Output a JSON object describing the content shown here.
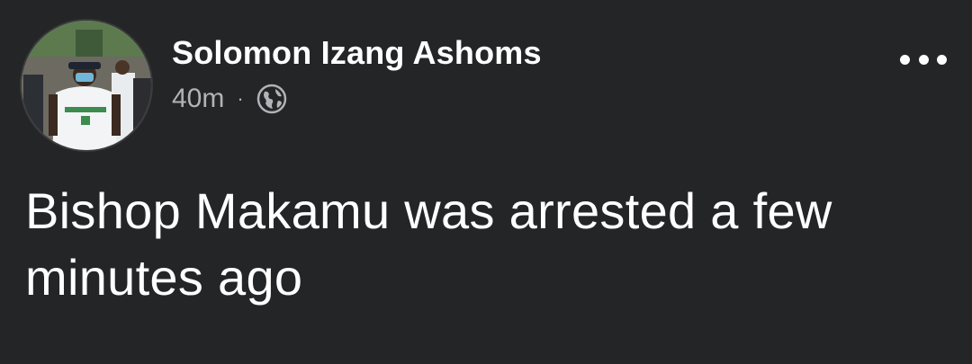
{
  "post": {
    "author_name": "Solomon Izang Ashoms",
    "timestamp": "40m",
    "separator": "·",
    "audience_icon": "globe-icon",
    "more_icon": "more-options-icon",
    "text": "Bishop Makamu was arrested a few minutes ago"
  },
  "colors": {
    "background": "#242526",
    "primary_text": "#ffffff",
    "secondary_text": "#b0b3b8"
  }
}
